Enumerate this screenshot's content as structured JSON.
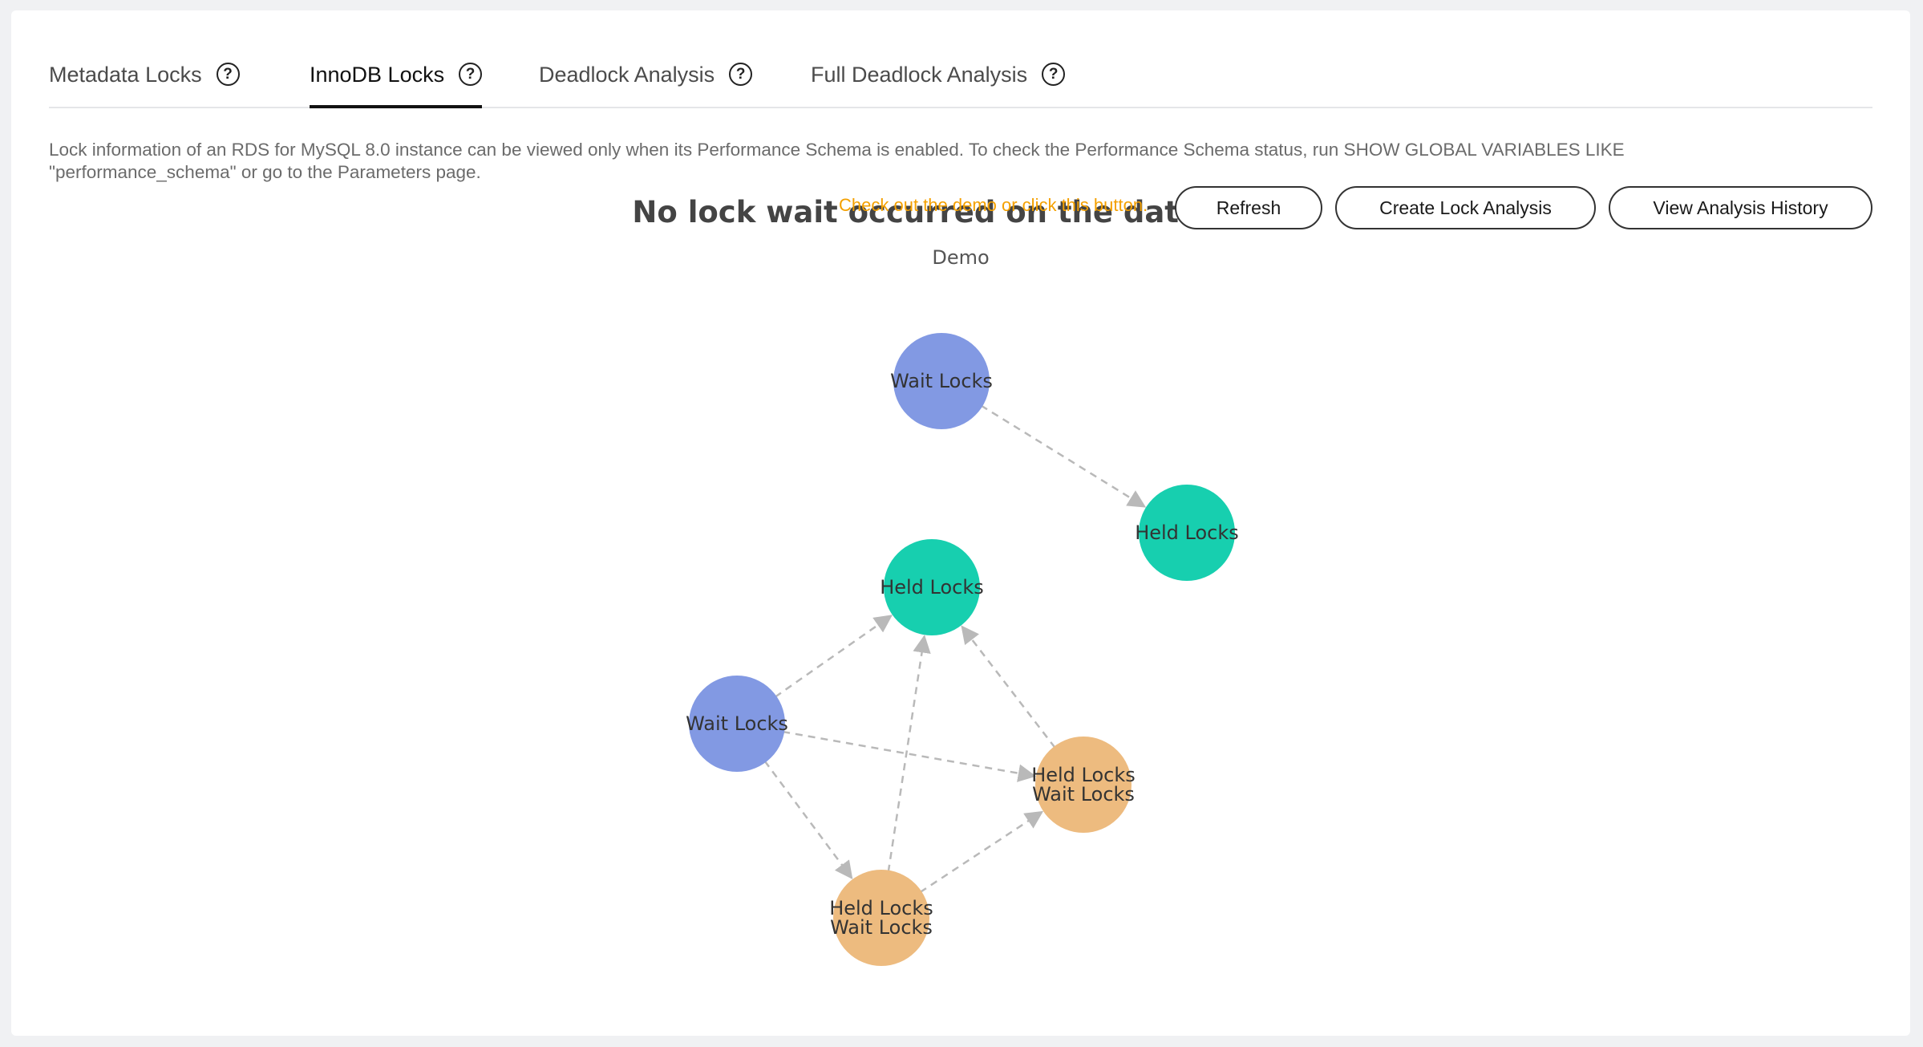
{
  "tabs": [
    {
      "label": "Metadata Locks",
      "active": false
    },
    {
      "label": "InnoDB Locks",
      "active": true
    },
    {
      "label": "Deadlock Analysis",
      "active": false
    },
    {
      "label": "Full Deadlock Analysis",
      "active": false
    }
  ],
  "help_glyph": "?",
  "info_text": "Lock information of an RDS for MySQL 8.0 instance can be viewed only when its Performance Schema is enabled. To check the Performance Schema status, run SHOW GLOBAL VARIABLES LIKE \"performance_schema\" or go to the Parameters page.",
  "hint_text": "Check out the demo or click this button.",
  "buttons": {
    "refresh": "Refresh",
    "create": "Create Lock Analysis",
    "history": "View Analysis History"
  },
  "empty_title": "No lock wait occurred on the database.",
  "demo_label": "Demo",
  "colors": {
    "wait": "#8299e3",
    "held": "#17cfaf",
    "both": "#edbb7f",
    "edge": "#b9b9b9",
    "hint": "#f4a000"
  },
  "graph": {
    "nodes": [
      {
        "id": "n1",
        "kind": "wait",
        "lines": [
          "Wait Locks"
        ]
      },
      {
        "id": "n2",
        "kind": "held",
        "lines": [
          "Held Locks"
        ]
      },
      {
        "id": "n3",
        "kind": "held",
        "lines": [
          "Held Locks"
        ]
      },
      {
        "id": "n4",
        "kind": "wait",
        "lines": [
          "Wait Locks"
        ]
      },
      {
        "id": "n5",
        "kind": "both",
        "lines": [
          "Held Locks",
          "Wait Locks"
        ]
      },
      {
        "id": "n6",
        "kind": "both",
        "lines": [
          "Held Locks",
          "Wait Locks"
        ]
      }
    ],
    "edges": [
      {
        "from": "n1",
        "to": "n2"
      },
      {
        "from": "n4",
        "to": "n3"
      },
      {
        "from": "n4",
        "to": "n5"
      },
      {
        "from": "n4",
        "to": "n6"
      },
      {
        "from": "n6",
        "to": "n3"
      },
      {
        "from": "n6",
        "to": "n5"
      },
      {
        "from": "n5",
        "to": "n3"
      }
    ]
  }
}
